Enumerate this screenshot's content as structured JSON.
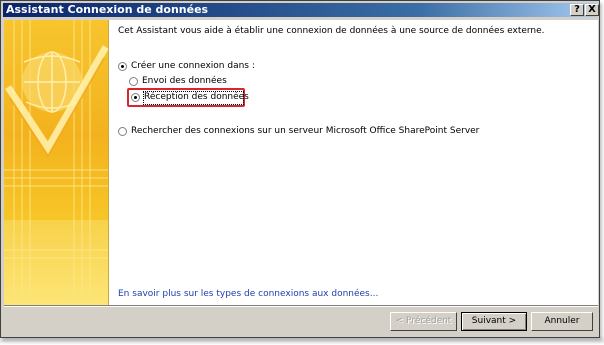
{
  "window": {
    "title": "Assistant Connexion de données",
    "help_glyph": "?",
    "close_glyph": "X"
  },
  "content": {
    "intro": "Cet Assistant vous aide à établir une connexion de données à une source de données externe.",
    "option_create": "Créer une connexion dans :",
    "option_send": "Envoi des données",
    "option_receive": "Réception des données",
    "option_search": "Rechercher des connexions sur un serveur Microsoft Office SharePoint Server",
    "learn_more_link": "En savoir plus sur les types de connexions aux données..."
  },
  "buttons": {
    "previous": "< Précédent",
    "next": "Suivant >",
    "cancel": "Annuler"
  },
  "colors": {
    "titlebar_start": "#0a246a",
    "accent_yellow": "#f6c628",
    "highlight_red": "#d9262e",
    "link_blue": "#1f3fae"
  }
}
